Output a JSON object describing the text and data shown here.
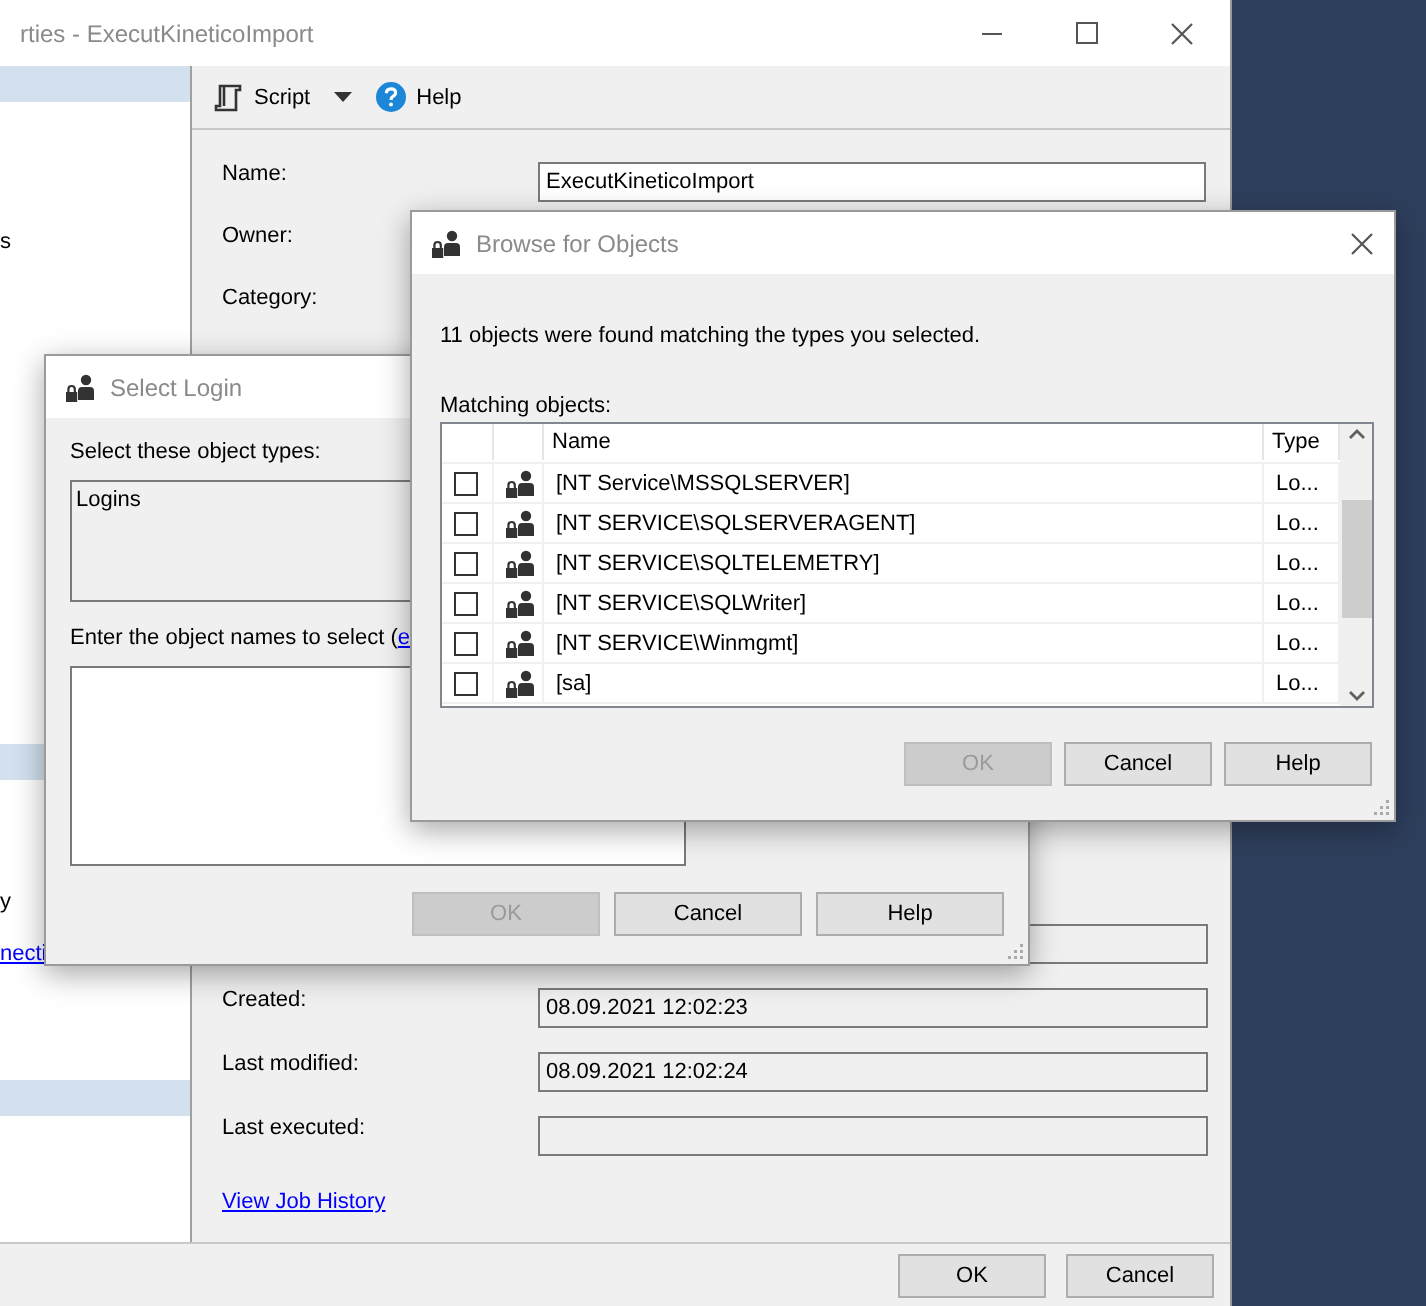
{
  "main_window": {
    "title": "rties - ExecutKineticoImport",
    "sidebar": [
      {
        "kind": "band"
      },
      {
        "kind": "text",
        "label": "s"
      },
      {
        "kind": "band"
      },
      {
        "kind": "text",
        "label": "y"
      },
      {
        "kind": "link",
        "label": "necti"
      },
      {
        "kind": "band"
      }
    ],
    "toolbar": {
      "script": "Script",
      "help": "Help"
    },
    "general_fields": [
      {
        "label": "Name:",
        "value": "ExecutKineticoImport"
      },
      {
        "label": "Owner:"
      },
      {
        "label": "Category:"
      }
    ],
    "info_fields": [
      {
        "read_only": true
      },
      {
        "label": "Created:",
        "value": "08.09.2021 12:02:23",
        "read_only": true
      },
      {
        "label": "Last modified:",
        "value": "08.09.2021 12:02:24",
        "read_only": true
      },
      {
        "label": "Last executed:",
        "read_only": true
      }
    ],
    "job_history_link": "View Job History",
    "buttons": [
      {
        "label": "OK",
        "disabled": false
      },
      {
        "label": "Cancel",
        "disabled": false
      }
    ]
  },
  "select_login": {
    "title": "Select Login",
    "types_label": "Select these object types:",
    "types_value": "Logins",
    "names_label": "Enter the object names to select (",
    "names_link": "e",
    "buttons": [
      {
        "label": "OK",
        "disabled": true
      },
      {
        "label": "Cancel",
        "disabled": false
      },
      {
        "label": "Help",
        "disabled": false
      }
    ]
  },
  "browse": {
    "title": "Browse for Objects",
    "message": "11 objects were found matching the types you selected.",
    "list_label": "Matching objects:",
    "columns": [
      "Name",
      "Type"
    ],
    "rows": [
      {
        "name": "[NT Service\\MSSQLSERVER]",
        "type": "Lo...",
        "checked": false
      },
      {
        "name": "[NT SERVICE\\SQLSERVERAGENT]",
        "type": "Lo...",
        "checked": false
      },
      {
        "name": "[NT SERVICE\\SQLTELEMETRY]",
        "type": "Lo...",
        "checked": false
      },
      {
        "name": "[NT SERVICE\\SQLWriter]",
        "type": "Lo...",
        "checked": false
      },
      {
        "name": "[NT SERVICE\\Winmgmt]",
        "type": "Lo...",
        "checked": false
      },
      {
        "name": "[sa]",
        "type": "Lo...",
        "checked": false
      }
    ],
    "buttons": [
      {
        "label": "OK",
        "disabled": true
      },
      {
        "label": "Cancel",
        "disabled": false
      },
      {
        "label": "Help",
        "disabled": false
      }
    ]
  }
}
